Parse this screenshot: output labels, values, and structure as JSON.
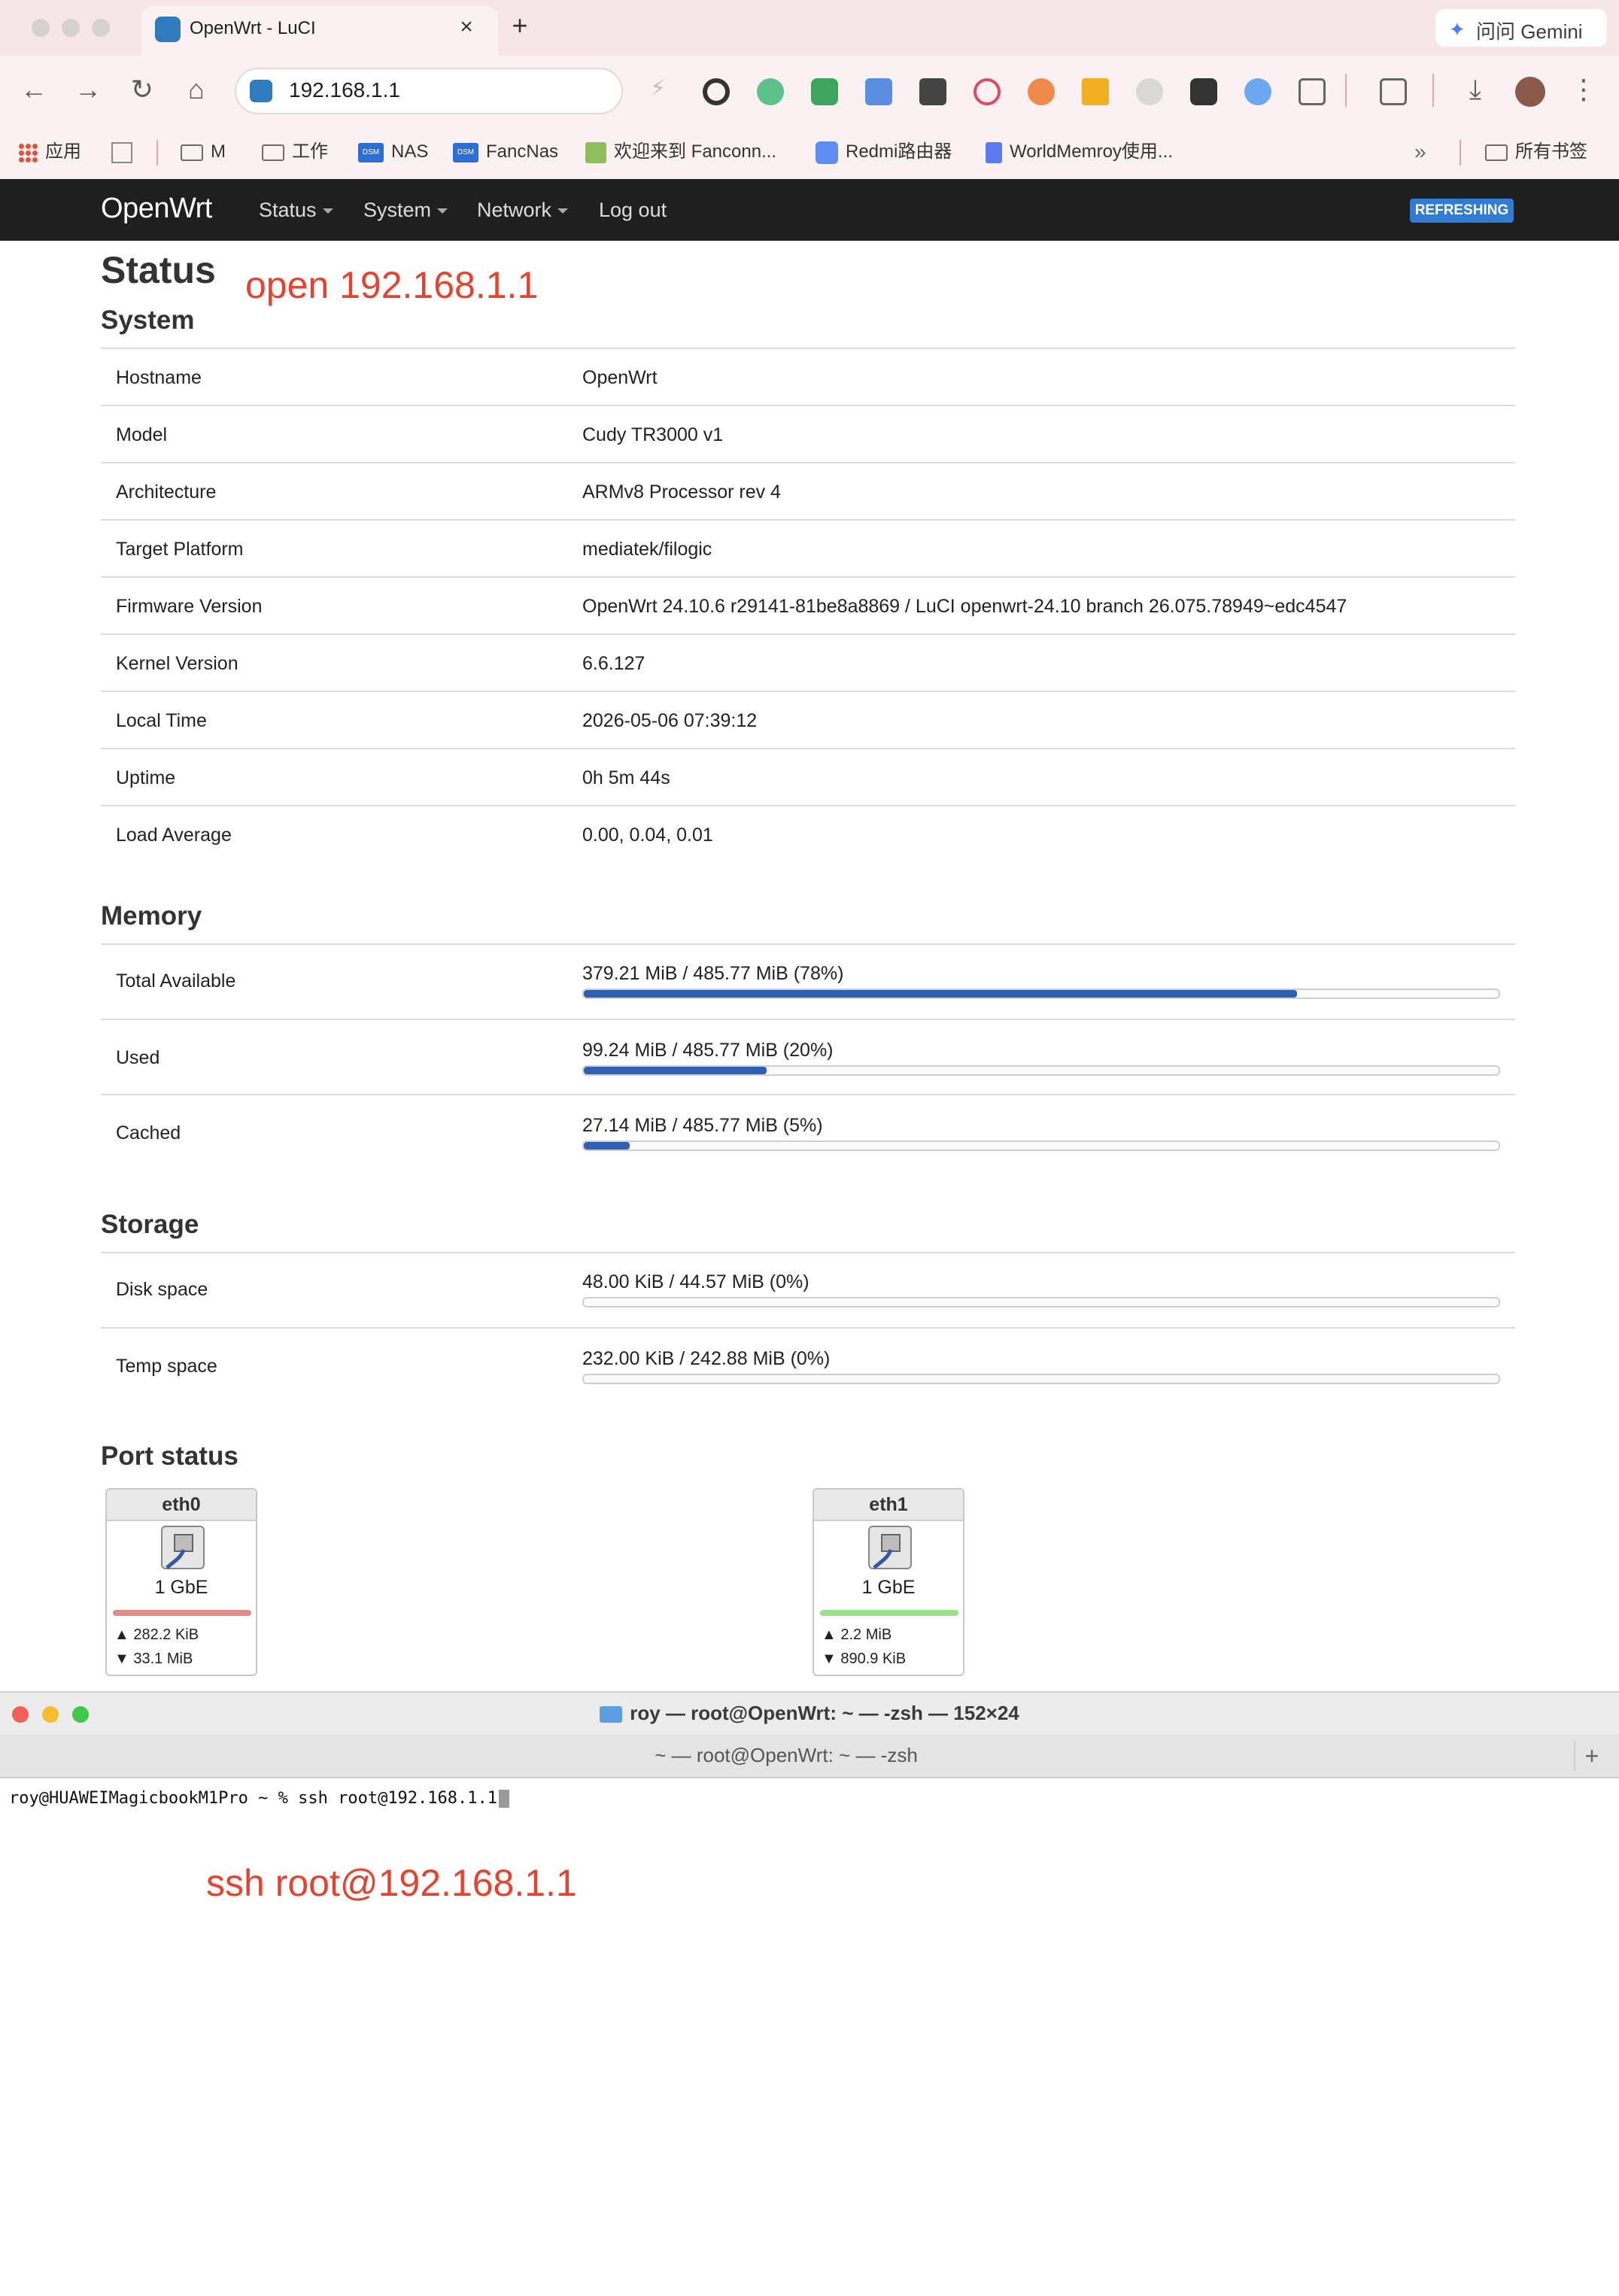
{
  "browser": {
    "tab_title": "OpenWrt - LuCI",
    "address": "192.168.1.1",
    "gemini_label": "问问 Gemini",
    "bookmarks": [
      {
        "label": "应用",
        "icon": "apps-grid-icon"
      },
      {
        "label": "",
        "icon": "grid-icon"
      },
      {
        "label": "M",
        "icon": "folder-icon"
      },
      {
        "label": "工作",
        "icon": "folder-icon"
      },
      {
        "label": "NAS",
        "icon": "dsm-icon"
      },
      {
        "label": "FancNas",
        "icon": "dsm-icon"
      },
      {
        "label": "欢迎来到 Fanconn...",
        "icon": "page-icon"
      },
      {
        "label": "Redmi路由器",
        "icon": "wifi-icon"
      },
      {
        "label": "WorldMemroy使用...",
        "icon": "doc-icon"
      }
    ],
    "all_bookmarks_label": "所有书签",
    "colors": {
      "tabstrip": "#f6e6e8",
      "toolbar": "#fcf1f2"
    }
  },
  "openwrt": {
    "brand": "OpenWrt",
    "menu": [
      "Status",
      "System",
      "Network",
      "Log out"
    ],
    "refreshing_badge": "REFRESHING",
    "page_title": "Status",
    "annotation_top": "open 192.168.1.1",
    "system": {
      "heading": "System",
      "rows": [
        {
          "label": "Hostname",
          "value": "OpenWrt"
        },
        {
          "label": "Model",
          "value": "Cudy TR3000 v1"
        },
        {
          "label": "Architecture",
          "value": "ARMv8 Processor rev 4"
        },
        {
          "label": "Target Platform",
          "value": "mediatek/filogic"
        },
        {
          "label": "Firmware Version",
          "value": "OpenWrt 24.10.6 r29141-81be8a8869 / LuCI openwrt-24.10 branch 26.075.78949~edc4547"
        },
        {
          "label": "Kernel Version",
          "value": "6.6.127"
        },
        {
          "label": "Local Time",
          "value": "2026-05-06 07:39:12"
        },
        {
          "label": "Uptime",
          "value": "0h 5m 44s"
        },
        {
          "label": "Load Average",
          "value": "0.00, 0.04, 0.01"
        }
      ]
    },
    "memory": {
      "heading": "Memory",
      "rows": [
        {
          "label": "Total Available",
          "value": "379.21 MiB / 485.77 MiB (78%)",
          "fraction": 0.78
        },
        {
          "label": "Used",
          "value": "99.24 MiB / 485.77 MiB (20%)",
          "fraction": 0.2
        },
        {
          "label": "Cached",
          "value": "27.14 MiB / 485.77 MiB (5%)",
          "fraction": 0.05
        }
      ]
    },
    "storage": {
      "heading": "Storage",
      "rows": [
        {
          "label": "Disk space",
          "value": "48.00 KiB / 44.57 MiB (0%)",
          "fraction": 0
        },
        {
          "label": "Temp space",
          "value": "232.00 KiB / 242.88 MiB (0%)",
          "fraction": 0
        }
      ]
    },
    "ports": {
      "heading": "Port status",
      "items": [
        {
          "name": "eth0",
          "speed": "1 GbE",
          "tx": "▲ 282.2 KiB",
          "rx": "▼ 33.1 MiB",
          "status_color": "#e08c8c"
        },
        {
          "name": "eth1",
          "speed": "1 GbE",
          "tx": "▲ 2.2 MiB",
          "rx": "▼ 890.9 KiB",
          "status_color": "#9be08c"
        }
      ]
    }
  },
  "terminal": {
    "window_title": "roy — root@OpenWrt: ~ — -zsh — 152×24",
    "tab_title": "~ — root@OpenWrt: ~ — -zsh",
    "command_line": "roy@HUAWEIMagicbookM1Pro ~ % ssh root@192.168.1.1",
    "annotation": "ssh root@192.168.1.1"
  }
}
